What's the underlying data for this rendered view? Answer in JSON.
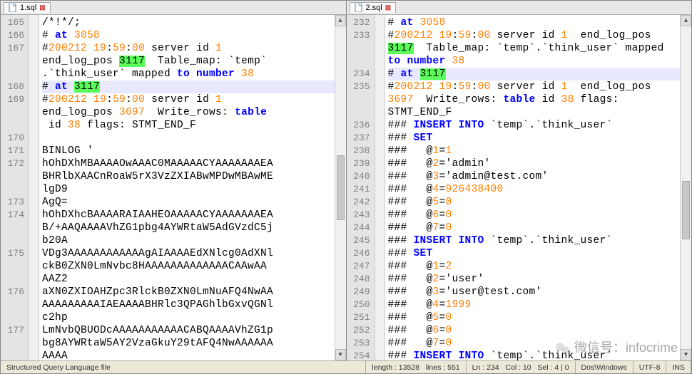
{
  "tabs": {
    "left": "1.sql",
    "right": "2.sql"
  },
  "left": {
    "lines": [
      {
        "n": "165",
        "seg": [
          {
            "t": "/*!*/;"
          }
        ]
      },
      {
        "n": "166",
        "seg": [
          {
            "t": "# "
          },
          {
            "t": "at",
            "c": "kw-blue"
          },
          {
            "t": " "
          },
          {
            "t": "3058",
            "c": "num-orange"
          }
        ]
      },
      {
        "n": "167",
        "seg": [
          {
            "t": "#"
          },
          {
            "t": "200212",
            "c": "num-orange"
          },
          {
            "t": " "
          },
          {
            "t": "19",
            "c": "num-orange"
          },
          {
            "t": ":"
          },
          {
            "t": "59",
            "c": "num-orange"
          },
          {
            "t": ":"
          },
          {
            "t": "00",
            "c": "num-orange"
          },
          {
            "t": " server id "
          },
          {
            "t": "1",
            "c": "num-orange"
          }
        ]
      },
      {
        "n": "",
        "seg": [
          {
            "t": "end_log_pos "
          },
          {
            "t": "3117",
            "c": "hi-green"
          },
          {
            "t": "  Table_map: `temp`"
          }
        ]
      },
      {
        "n": "",
        "seg": [
          {
            "t": ".`think_user` mapped "
          },
          {
            "t": "to number",
            "c": "kw-blue"
          },
          {
            "t": " "
          },
          {
            "t": "38",
            "c": "num-orange"
          }
        ]
      },
      {
        "n": "168",
        "hl": true,
        "seg": [
          {
            "t": "# "
          },
          {
            "t": "at",
            "c": "kw-blue"
          },
          {
            "t": " "
          },
          {
            "t": "3117",
            "c": "hi-green"
          }
        ]
      },
      {
        "n": "169",
        "seg": [
          {
            "t": "#"
          },
          {
            "t": "200212",
            "c": "num-orange"
          },
          {
            "t": " "
          },
          {
            "t": "19",
            "c": "num-orange"
          },
          {
            "t": ":"
          },
          {
            "t": "59",
            "c": "num-orange"
          },
          {
            "t": ":"
          },
          {
            "t": "00",
            "c": "num-orange"
          },
          {
            "t": " server id "
          },
          {
            "t": "1",
            "c": "num-orange"
          }
        ]
      },
      {
        "n": "",
        "seg": [
          {
            "t": "end_log_pos "
          },
          {
            "t": "3697",
            "c": "num-orange"
          },
          {
            "t": "  Write_rows: "
          },
          {
            "t": "table",
            "c": "kw-blue"
          }
        ]
      },
      {
        "n": "",
        "seg": [
          {
            "t": " id "
          },
          {
            "t": "38",
            "c": "num-orange"
          },
          {
            "t": " flags: STMT_END_F"
          }
        ]
      },
      {
        "n": "170",
        "seg": [
          {
            "t": ""
          }
        ]
      },
      {
        "n": "171",
        "seg": [
          {
            "t": "BINLOG '"
          }
        ]
      },
      {
        "n": "172",
        "seg": [
          {
            "t": "hOhDXhMBAAAAOwAAAC0MAAAAACYAAAAAAAEA"
          }
        ]
      },
      {
        "n": "",
        "seg": [
          {
            "t": "BHRlbXAACnRoaW5rX3VzZXIABwMPDwMBAwME"
          }
        ]
      },
      {
        "n": "",
        "seg": [
          {
            "t": "lgD9"
          }
        ]
      },
      {
        "n": "173",
        "seg": [
          {
            "t": "AgQ="
          }
        ]
      },
      {
        "n": "174",
        "seg": [
          {
            "t": "hOhDXhcBAAAARAIAAHEOAAAAACYAAAAAAAEA"
          }
        ]
      },
      {
        "n": "",
        "seg": [
          {
            "t": "B/+AAQAAAAVhZG1pbg4AYWRtaW5AdGVzdC5j"
          }
        ]
      },
      {
        "n": "",
        "seg": [
          {
            "t": "b20A"
          }
        ]
      },
      {
        "n": "175",
        "seg": [
          {
            "t": "VDg3AAAAAAAAAAAAgAIAAAAEdXNlcg0AdXNl"
          }
        ]
      },
      {
        "n": "",
        "seg": [
          {
            "t": "ckB0ZXN0LmNvbc8HAAAAAAAAAAAAACAAwAA"
          }
        ]
      },
      {
        "n": "",
        "seg": [
          {
            "t": "AAZ2"
          }
        ]
      },
      {
        "n": "176",
        "seg": [
          {
            "t": "aXN0ZXIOAHZpc3RlckB0ZXN0LmNuAFQ4NwAA"
          }
        ]
      },
      {
        "n": "",
        "seg": [
          {
            "t": "AAAAAAAAAIAEAAAABHRlc3QPAGhlbGxvQGNl"
          }
        ]
      },
      {
        "n": "",
        "seg": [
          {
            "t": "c2hp"
          }
        ]
      },
      {
        "n": "177",
        "seg": [
          {
            "t": "LmNvbQBUODcAAAAAAAAAAACABQAAAAVhZG1p"
          }
        ]
      },
      {
        "n": "",
        "seg": [
          {
            "t": "bg8AYWRtaW5AY2VzaGkuY29tAFQ4NwAAAAAA"
          }
        ]
      },
      {
        "n": "",
        "seg": [
          {
            "t": "AAAA"
          }
        ]
      }
    ]
  },
  "right": {
    "lines": [
      {
        "n": "232",
        "seg": [
          {
            "t": "# "
          },
          {
            "t": "at",
            "c": "kw-blue"
          },
          {
            "t": " "
          },
          {
            "t": "3058",
            "c": "num-orange"
          }
        ]
      },
      {
        "n": "233",
        "seg": [
          {
            "t": "#"
          },
          {
            "t": "200212",
            "c": "num-orange"
          },
          {
            "t": " "
          },
          {
            "t": "19",
            "c": "num-orange"
          },
          {
            "t": ":"
          },
          {
            "t": "59",
            "c": "num-orange"
          },
          {
            "t": ":"
          },
          {
            "t": "00",
            "c": "num-orange"
          },
          {
            "t": " server id "
          },
          {
            "t": "1",
            "c": "num-orange"
          },
          {
            "t": "  end_log_pos"
          }
        ]
      },
      {
        "n": "",
        "seg": [
          {
            "t": "3117",
            "c": "hi-green"
          },
          {
            "t": "  Table_map: `temp`.`think_user` mapped"
          }
        ]
      },
      {
        "n": "",
        "seg": [
          {
            "t": "to number",
            "c": "kw-blue"
          },
          {
            "t": " "
          },
          {
            "t": "38",
            "c": "num-orange"
          }
        ]
      },
      {
        "n": "234",
        "hl": true,
        "seg": [
          {
            "t": "# "
          },
          {
            "t": "at",
            "c": "kw-blue"
          },
          {
            "t": " "
          },
          {
            "t": "3117",
            "c": "hi-green"
          }
        ]
      },
      {
        "n": "235",
        "seg": [
          {
            "t": "#"
          },
          {
            "t": "200212",
            "c": "num-orange"
          },
          {
            "t": " "
          },
          {
            "t": "19",
            "c": "num-orange"
          },
          {
            "t": ":"
          },
          {
            "t": "59",
            "c": "num-orange"
          },
          {
            "t": ":"
          },
          {
            "t": "00",
            "c": "num-orange"
          },
          {
            "t": " server id "
          },
          {
            "t": "1",
            "c": "num-orange"
          },
          {
            "t": "  end_log_pos"
          }
        ]
      },
      {
        "n": "",
        "seg": [
          {
            "t": "3697",
            "c": "num-orange"
          },
          {
            "t": "  Write_rows: "
          },
          {
            "t": "table",
            "c": "kw-blue"
          },
          {
            "t": " id "
          },
          {
            "t": "38",
            "c": "num-orange"
          },
          {
            "t": " flags:"
          }
        ]
      },
      {
        "n": "",
        "seg": [
          {
            "t": "STMT_END_F"
          }
        ]
      },
      {
        "n": "236",
        "seg": [
          {
            "t": "### "
          },
          {
            "t": "INSERT INTO",
            "c": "kw-blue"
          },
          {
            "t": " `temp`.`think_user`"
          }
        ]
      },
      {
        "n": "237",
        "seg": [
          {
            "t": "### "
          },
          {
            "t": "SET",
            "c": "kw-blue"
          }
        ]
      },
      {
        "n": "238",
        "seg": [
          {
            "t": "###   @"
          },
          {
            "t": "1",
            "c": "num-orange"
          },
          {
            "t": "="
          },
          {
            "t": "1",
            "c": "num-orange"
          }
        ]
      },
      {
        "n": "239",
        "seg": [
          {
            "t": "###   @"
          },
          {
            "t": "2",
            "c": "num-orange"
          },
          {
            "t": "='admin'"
          }
        ]
      },
      {
        "n": "240",
        "seg": [
          {
            "t": "###   @"
          },
          {
            "t": "3",
            "c": "num-orange"
          },
          {
            "t": "='admin@test.com'"
          }
        ]
      },
      {
        "n": "241",
        "seg": [
          {
            "t": "###   @"
          },
          {
            "t": "4",
            "c": "num-orange"
          },
          {
            "t": "="
          },
          {
            "t": "926438400",
            "c": "num-orange"
          }
        ]
      },
      {
        "n": "242",
        "seg": [
          {
            "t": "###   @"
          },
          {
            "t": "5",
            "c": "num-orange"
          },
          {
            "t": "="
          },
          {
            "t": "0",
            "c": "num-orange"
          }
        ]
      },
      {
        "n": "243",
        "seg": [
          {
            "t": "###   @"
          },
          {
            "t": "6",
            "c": "num-orange"
          },
          {
            "t": "="
          },
          {
            "t": "0",
            "c": "num-orange"
          }
        ]
      },
      {
        "n": "244",
        "seg": [
          {
            "t": "###   @"
          },
          {
            "t": "7",
            "c": "num-orange"
          },
          {
            "t": "="
          },
          {
            "t": "0",
            "c": "num-orange"
          }
        ]
      },
      {
        "n": "245",
        "seg": [
          {
            "t": "### "
          },
          {
            "t": "INSERT INTO",
            "c": "kw-blue"
          },
          {
            "t": " `temp`.`think_user`"
          }
        ]
      },
      {
        "n": "246",
        "seg": [
          {
            "t": "### "
          },
          {
            "t": "SET",
            "c": "kw-blue"
          }
        ]
      },
      {
        "n": "247",
        "seg": [
          {
            "t": "###   @"
          },
          {
            "t": "1",
            "c": "num-orange"
          },
          {
            "t": "="
          },
          {
            "t": "2",
            "c": "num-orange"
          }
        ]
      },
      {
        "n": "248",
        "seg": [
          {
            "t": "###   @"
          },
          {
            "t": "2",
            "c": "num-orange"
          },
          {
            "t": "='user'"
          }
        ]
      },
      {
        "n": "249",
        "seg": [
          {
            "t": "###   @"
          },
          {
            "t": "3",
            "c": "num-orange"
          },
          {
            "t": "='user@test.com'"
          }
        ]
      },
      {
        "n": "250",
        "seg": [
          {
            "t": "###   @"
          },
          {
            "t": "4",
            "c": "num-orange"
          },
          {
            "t": "="
          },
          {
            "t": "1999",
            "c": "num-orange"
          }
        ]
      },
      {
        "n": "251",
        "seg": [
          {
            "t": "###   @"
          },
          {
            "t": "5",
            "c": "num-orange"
          },
          {
            "t": "="
          },
          {
            "t": "0",
            "c": "num-orange"
          }
        ]
      },
      {
        "n": "252",
        "seg": [
          {
            "t": "###   @"
          },
          {
            "t": "6",
            "c": "num-orange"
          },
          {
            "t": "="
          },
          {
            "t": "0",
            "c": "num-orange"
          }
        ]
      },
      {
        "n": "253",
        "seg": [
          {
            "t": "###   @"
          },
          {
            "t": "7",
            "c": "num-orange"
          },
          {
            "t": "="
          },
          {
            "t": "0",
            "c": "num-orange"
          }
        ]
      },
      {
        "n": "254",
        "seg": [
          {
            "t": "### "
          },
          {
            "t": "INSERT INTO",
            "c": "kw-blue"
          },
          {
            "t": " `temp`.`think_user`"
          }
        ]
      }
    ]
  },
  "statusbar": {
    "filetype": "Structured Query Language file",
    "length_label": "length :",
    "length": "13528",
    "lines_label": "lines :",
    "lines": "551",
    "ln_label": "Ln :",
    "ln": "234",
    "col_label": "Col :",
    "col": "10",
    "sel_label": "Sel :",
    "sel1": "4",
    "sel2": "0",
    "eol": "Dos\\Windows",
    "encoding": "UTF-8",
    "mode": "INS"
  },
  "watermark": {
    "label": "微信号：",
    "value": "infocrime"
  }
}
